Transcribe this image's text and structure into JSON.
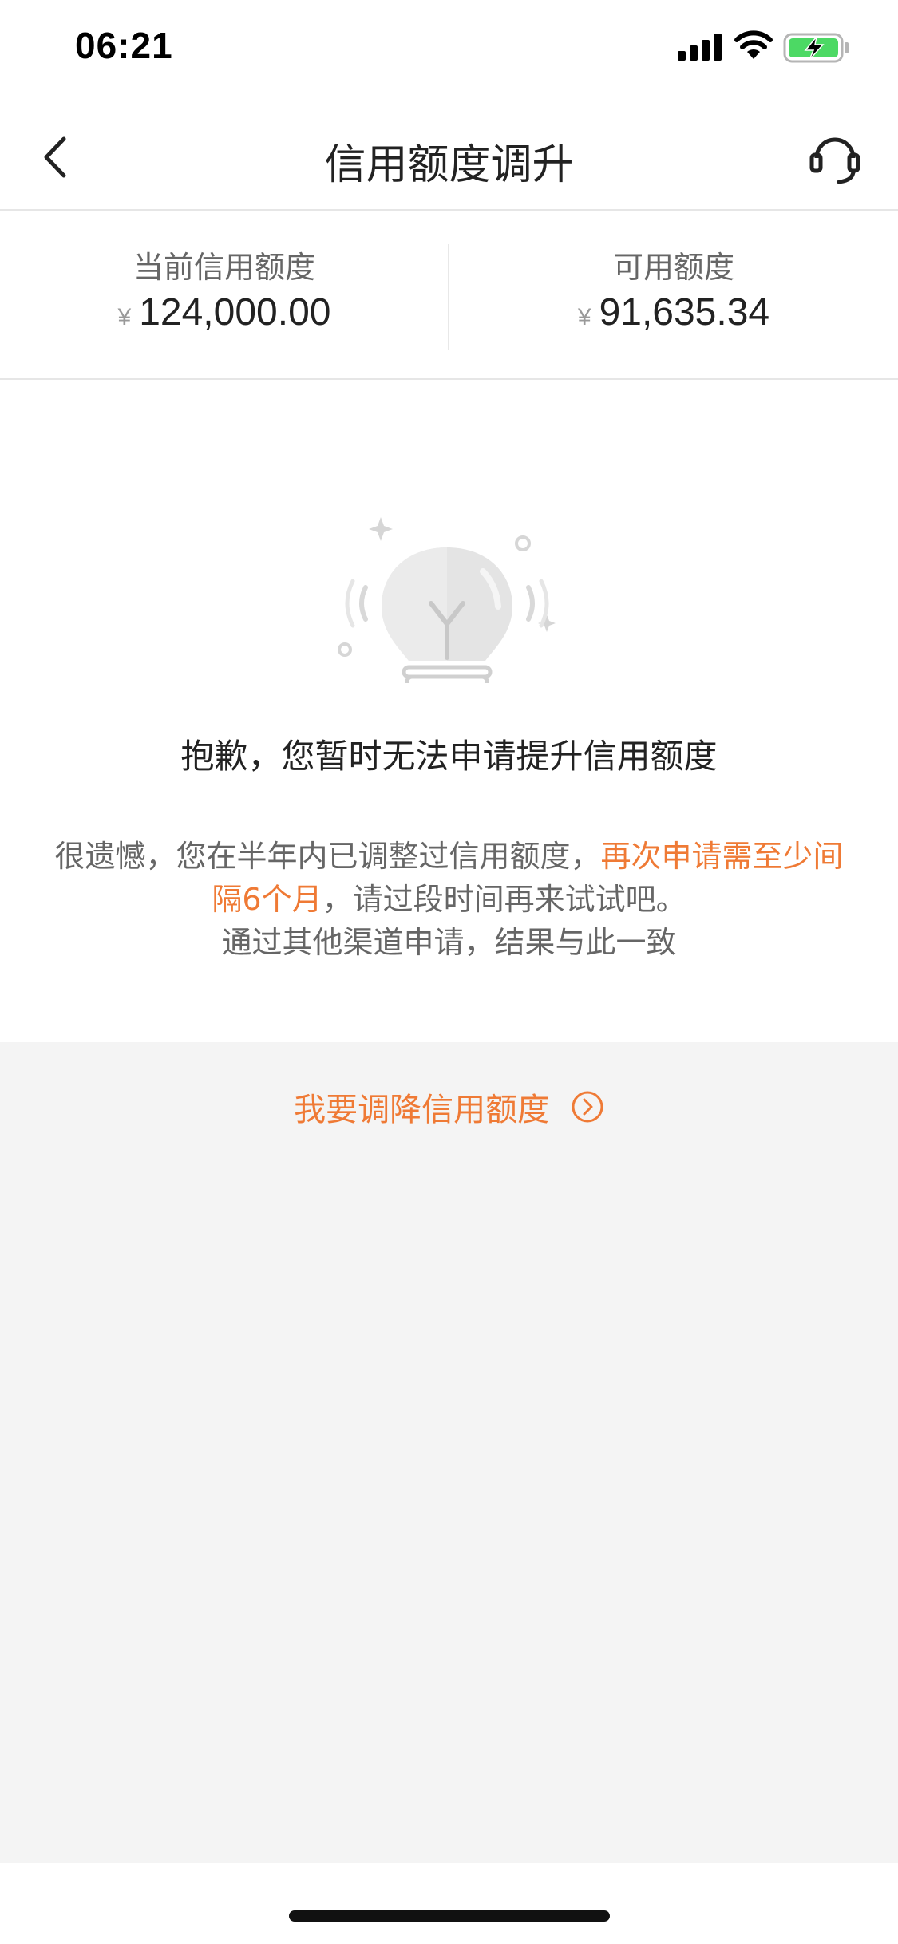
{
  "status_bar": {
    "time": "06:21",
    "icons": [
      "signal-icon",
      "wifi-icon",
      "battery-charging-icon"
    ]
  },
  "nav": {
    "title": "信用额度调升",
    "back_icon": "chevron-left-icon",
    "service_icon": "headset-icon"
  },
  "summary": {
    "current_label": "当前信用额度",
    "current_currency": "¥",
    "current_amount": "124,000.00",
    "available_label": "可用额度",
    "available_currency": "¥",
    "available_amount": "91,635.34"
  },
  "result": {
    "illustration_icon": "lightbulb-icon",
    "title": "抱歉，您暂时无法申请提升信用额度",
    "desc_part1": "很遗憾，您在半年内已调整过信用额度，",
    "desc_highlight": "再次申请需至少间隔6个月",
    "desc_part2": "，请过段时间再来试试吧。",
    "desc_line3": "通过其他渠道申请，结果与此一致"
  },
  "reduce_link": {
    "label": "我要调降信用额度",
    "icon": "circle-chevron-right-icon"
  },
  "colors": {
    "accent": "#ef7a35",
    "background": "#f4f4f4"
  }
}
